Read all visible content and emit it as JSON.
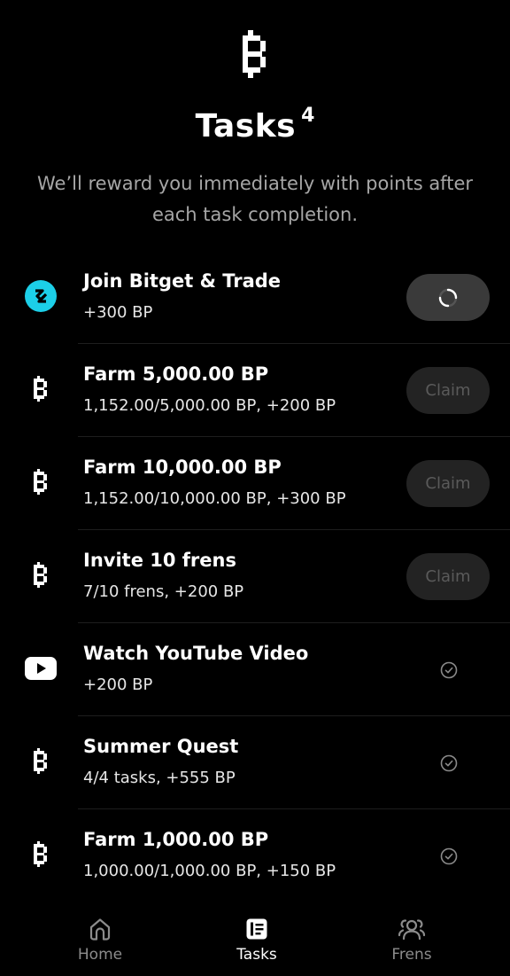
{
  "header": {
    "title": "Tasks",
    "count": "4",
    "subtitle": "We’ll reward you immediately with points after each task completion."
  },
  "tasks": [
    {
      "name": "Join Bitget & Trade",
      "reward": "+300 BP",
      "icon": "bitget-icon",
      "state": "loading"
    },
    {
      "name": "Farm 5,000.00 BP",
      "reward": "1,152.00/5,000.00 BP, +200 BP",
      "icon": "blum-icon",
      "state": "claim",
      "button_label": "Claim"
    },
    {
      "name": "Farm 10,000.00 BP",
      "reward": "1,152.00/10,000.00 BP, +300 BP",
      "icon": "blum-icon",
      "state": "claim",
      "button_label": "Claim"
    },
    {
      "name": "Invite 10 frens",
      "reward": "7/10 frens, +200 BP",
      "icon": "blum-icon",
      "state": "claim",
      "button_label": "Claim"
    },
    {
      "name": "Watch YouTube Video",
      "reward": "+200 BP",
      "icon": "youtube-icon",
      "state": "done"
    },
    {
      "name": "Summer Quest",
      "reward": "4/4 tasks, +555 BP",
      "icon": "blum-icon",
      "state": "done"
    },
    {
      "name": "Farm 1,000.00 BP",
      "reward": "1,000.00/1,000.00 BP, +150 BP",
      "icon": "blum-icon",
      "state": "done"
    }
  ],
  "nav": {
    "home_label": "Home",
    "tasks_label": "Tasks",
    "frens_label": "Frens",
    "active": "tasks"
  },
  "colors": {
    "background": "#000000",
    "button_bg": "#232323",
    "button_text": "#5a5a5a",
    "bitget_cyan": "#1ccfe8",
    "muted_text": "#a6a6a6"
  }
}
